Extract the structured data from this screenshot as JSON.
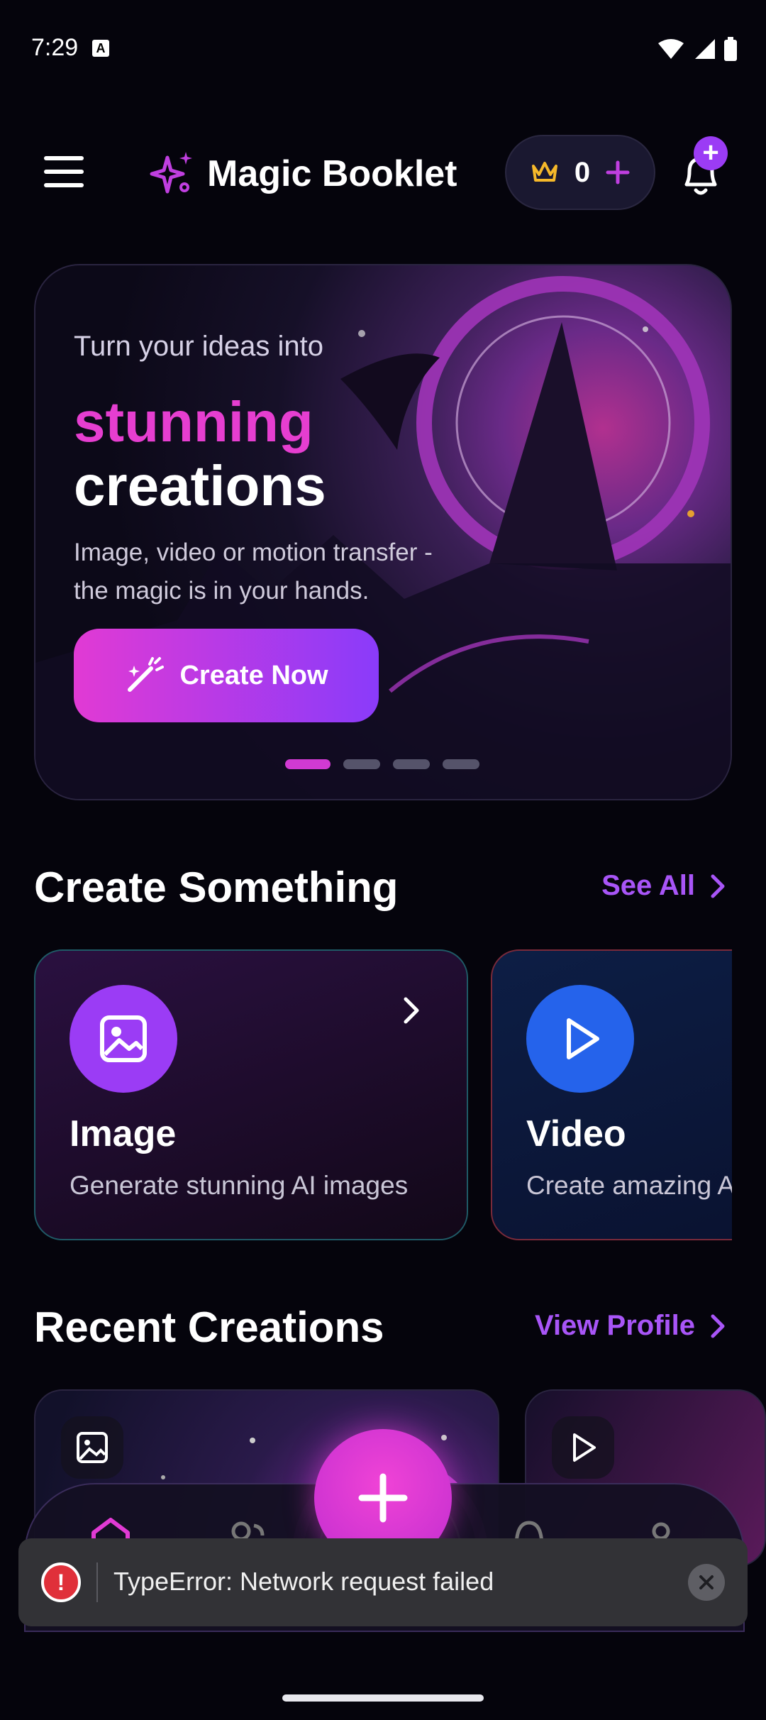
{
  "status_bar": {
    "time": "7:29",
    "notification_badge": "A"
  },
  "header": {
    "app_title": "Magic Booklet",
    "credits_count": "0",
    "icons": {
      "menu": "hamburger-menu-icon",
      "brand": "sparkle-icon",
      "credits": "crown-icon",
      "notifications": "bell-icon"
    }
  },
  "hero": {
    "pre_title": "Turn your ideas into",
    "title_highlight": "stunning",
    "title_main": "creations",
    "description": "Image, video or motion transfer - the magic is in your hands.",
    "cta_label": "Create Now",
    "carousel_active_index": 0,
    "carousel_count": 4
  },
  "create_section": {
    "title": "Create Something",
    "link_label": "See All",
    "cards": [
      {
        "title": "Image",
        "description": "Generate stunning AI images",
        "icon": "image-icon",
        "color": "#9b3cf5"
      },
      {
        "title": "Video",
        "description": "Create amazing AI videos",
        "icon": "play-icon",
        "color": "#2563eb"
      }
    ]
  },
  "recent_section": {
    "title": "Recent Creations",
    "link_label": "View Profile",
    "items": [
      {
        "type": "image",
        "icon": "image-icon"
      },
      {
        "type": "video",
        "icon": "play-icon"
      }
    ]
  },
  "bottom_nav": {
    "items": [
      "home-icon",
      "community-icon",
      "create-plus-icon",
      "notifications-icon",
      "profile-icon"
    ]
  },
  "toast": {
    "message": "TypeError: Network request failed",
    "icon": "error-icon"
  },
  "colors": {
    "accent_pink": "#e63ed0",
    "accent_purple": "#a855f7",
    "background": "#05040c",
    "error": "#e0303a"
  }
}
